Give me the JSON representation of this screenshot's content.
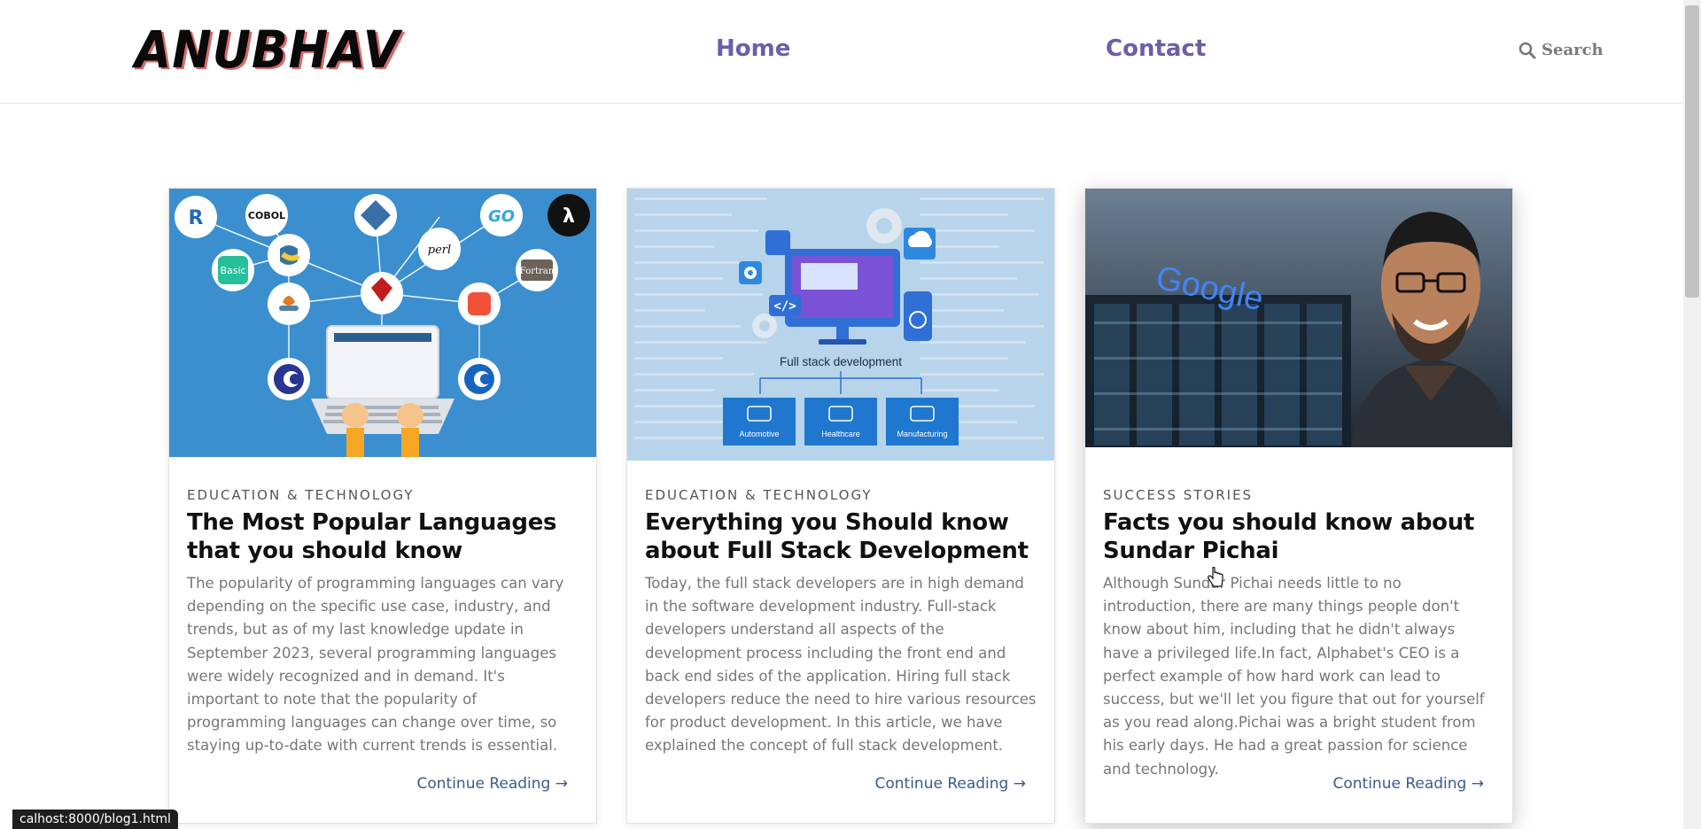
{
  "header": {
    "logo": "ANUBHAV",
    "nav": [
      {
        "label": "Home"
      },
      {
        "label": "Contact"
      }
    ],
    "search_label": "Search",
    "search_icon": "search-icon"
  },
  "cards": [
    {
      "category": "EDUCATION & TECHNOLOGY",
      "title": "The Most Popular Languages that you should know",
      "excerpt": "The popularity of programming languages can vary depending on the specific use case, industry, and trends, but as of my last knowledge update in September 2023, several programming languages were widely recognized and in demand. It's important to note that the popularity of programming languages can change over time, so staying up-to-date with current trends is essential.",
      "link": "Continue Reading →",
      "image": {
        "badges": [
          "R",
          "COBOL",
          "GO",
          "Basic",
          "perl",
          "Fortran"
        ]
      }
    },
    {
      "category": "EDUCATION & TECHNOLOGY",
      "title": "Everything you Should know about Full Stack Development",
      "excerpt": "Today, the full stack developers are in high demand in the software development industry. Full-stack developers understand all aspects of the development process including the front end and back end sides of the application. Hiring full stack developers reduce the need to hire various resources for product development. In this article, we have explained the concept of full stack development.",
      "link": "Continue Reading →",
      "image": {
        "caption": "Full stack development",
        "boxes": [
          "Automotive",
          "Healthcare",
          "Manufacturing"
        ]
      }
    },
    {
      "category": "SUCCESS STORIES",
      "title": "Facts you should know about Sundar Pichai",
      "excerpt": "Although Sundar Pichai needs little to no introduction, there are many things people don't know about him, including that he didn't always have a privileged life.In fact, Alphabet's CEO is a perfect example of how hard work can lead to success, but we'll let you figure that out for yourself as you read along.Pichai was a bright student from his early days. He had a great passion for science and technology.",
      "link": "Continue Reading →",
      "image": {
        "sign": "Google"
      }
    }
  ],
  "status_url": "calhost:8000/blog1.html",
  "colors": {
    "nav": "#6b5eaa",
    "link": "#3d5a8c",
    "img1_bg": "#3b8fcf",
    "img2_bg": "#b8d4ea"
  }
}
